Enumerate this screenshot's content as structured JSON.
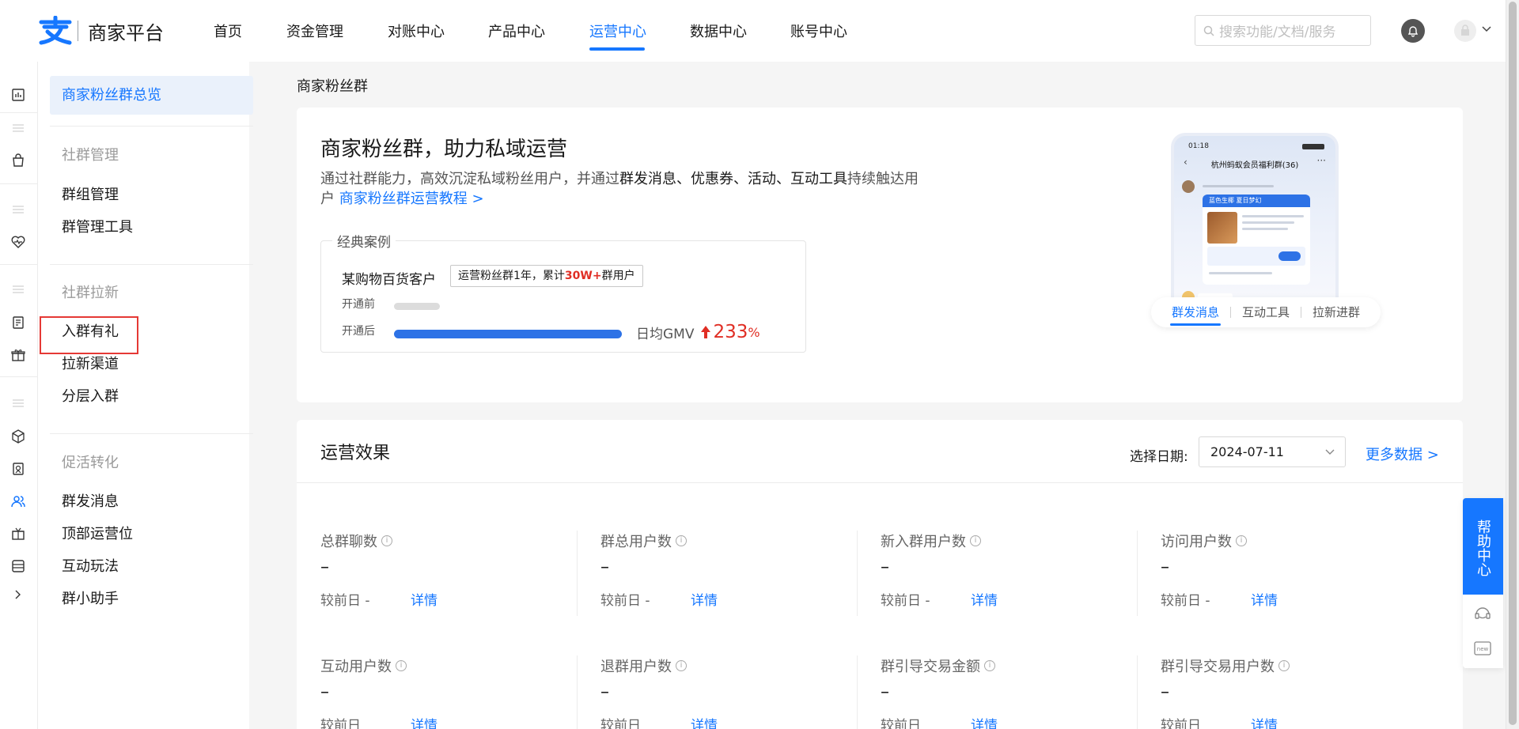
{
  "header": {
    "logo_text": "商家平台",
    "nav": [
      {
        "label": "首页"
      },
      {
        "label": "资金管理"
      },
      {
        "label": "对账中心"
      },
      {
        "label": "产品中心"
      },
      {
        "label": "运营中心",
        "active": true
      },
      {
        "label": "数据中心"
      },
      {
        "label": "账号中心"
      }
    ],
    "search_placeholder": "搜索功能/文档/服务"
  },
  "sidebar": {
    "overview": "商家粉丝群总览",
    "groups": [
      {
        "title": "社群管理",
        "items": [
          "群组管理",
          "群管理工具"
        ]
      },
      {
        "title": "社群拉新",
        "items": [
          "入群有礼",
          "拉新渠道",
          "分层入群"
        ]
      },
      {
        "title": "促活转化",
        "items": [
          "群发消息",
          "顶部运营位",
          "互动玩法",
          "群小助手"
        ]
      }
    ]
  },
  "breadcrumb": "商家粉丝群",
  "hero": {
    "title": "商家粉丝群，助力私域运营",
    "desc_prefix": "通过社群能力，高效沉淀私域粉丝用户，并通过",
    "desc_bold": "群发消息、优惠券、活动、互动工具",
    "desc_suffix": "持续触达用户",
    "tutorial_link": "商家粉丝群运营教程 >",
    "case": {
      "legend": "经典案例",
      "client": "某购物百货客户",
      "tag_prefix": "运营粉丝群1年，累计",
      "tag_highlight": "30W+",
      "tag_suffix": "群用户",
      "before_label": "开通前",
      "after_label": "开通后",
      "metric_label": "日均GMV",
      "metric_value": "233",
      "metric_unit": "%"
    },
    "phone": {
      "time": "01:18",
      "title": "杭州蚂蚁会员福利群(36)",
      "card_head": "蓝色生椰 夏日梦幻"
    },
    "phone_tabs": [
      {
        "label": "群发消息",
        "active": true
      },
      {
        "label": "互动工具"
      },
      {
        "label": "拉新进群"
      }
    ]
  },
  "effect": {
    "title": "运营效果",
    "date_label": "选择日期:",
    "date_value": "2024-07-11",
    "more_data": "更多数据 >",
    "metrics": [
      {
        "title": "总群聊数",
        "value": "–",
        "compare": "较前日 -",
        "link": "详情"
      },
      {
        "title": "群总用户数",
        "value": "–",
        "compare": "较前日 -",
        "link": "详情"
      },
      {
        "title": "新入群用户数",
        "value": "–",
        "compare": "较前日 -",
        "link": "详情"
      },
      {
        "title": "访问用户数",
        "value": "–",
        "compare": "较前日 -",
        "link": "详情"
      },
      {
        "title": "互动用户数",
        "value": "–",
        "compare": "较前日",
        "link": "详情"
      },
      {
        "title": "退群用户数",
        "value": "–",
        "compare": "较前日",
        "link": "详情"
      },
      {
        "title": "群引导交易金额",
        "value": "–",
        "compare": "较前日",
        "link": "详情"
      },
      {
        "title": "群引导交易用户数",
        "value": "–",
        "compare": "较前日",
        "link": "详情"
      }
    ]
  },
  "help": {
    "label": "帮助中心"
  },
  "colors": {
    "accent": "#1677ff",
    "highlight_red": "#e02e24",
    "selection_border": "#e53935"
  }
}
